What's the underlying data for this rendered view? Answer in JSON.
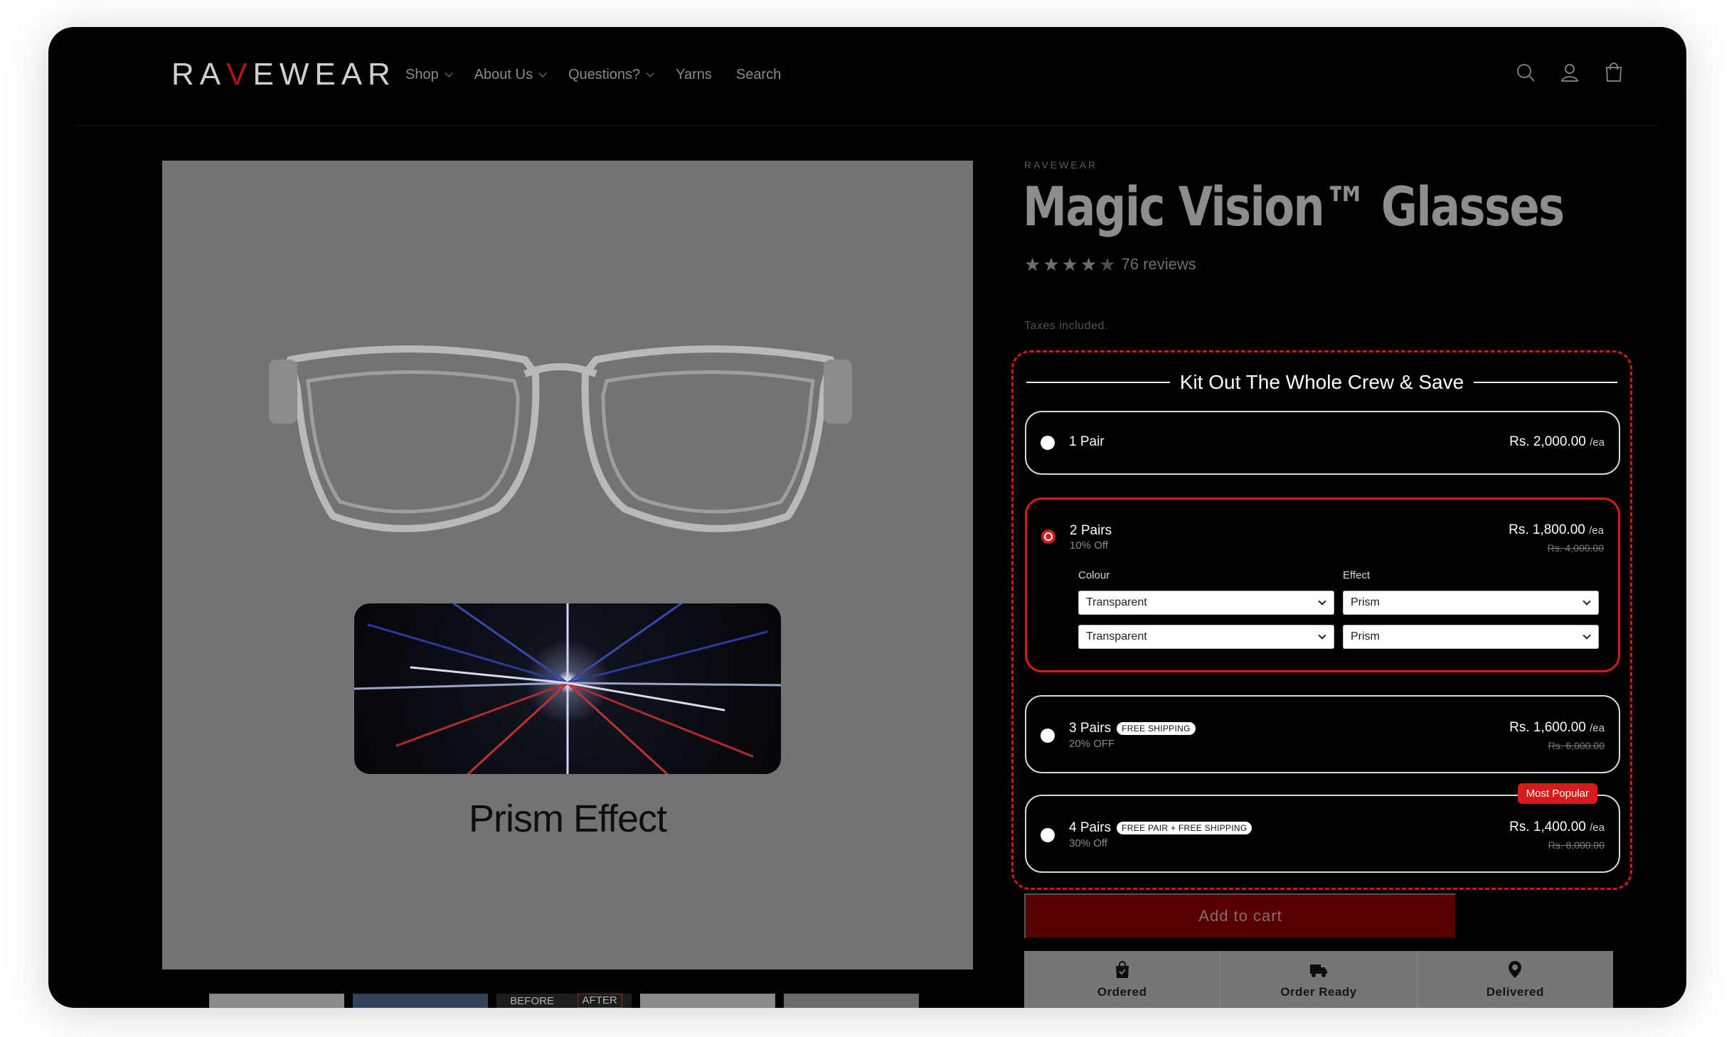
{
  "brand": {
    "logo_text_a": "RA",
    "logo_text_v": "V",
    "logo_text_b": "EWEAR"
  },
  "nav": [
    {
      "label": "Shop",
      "dropdown": true
    },
    {
      "label": "About Us",
      "dropdown": true
    },
    {
      "label": "Questions?",
      "dropdown": true
    },
    {
      "label": "Yarns",
      "dropdown": false
    },
    {
      "label": "Search",
      "dropdown": false
    }
  ],
  "header_icons": [
    "search-icon",
    "account-icon",
    "cart-icon"
  ],
  "media": {
    "overlay_label": "Prism Effect",
    "thumbs": {
      "before": "BEFORE",
      "after": "AFTER"
    }
  },
  "product": {
    "vendor": "RAVEWEAR",
    "title": "Magic Vision™ Glasses",
    "rating": 4.5,
    "reviews": "76 reviews",
    "taxes": "Taxes included."
  },
  "bundle": {
    "title": "Kit Out The Whole Crew & Save",
    "options": [
      {
        "name": "1 Pair",
        "sub": "",
        "pill": "",
        "price": "Rs. 2,000.00",
        "unit": "/ea",
        "compare": "",
        "badge": "",
        "selected": false
      },
      {
        "name": "2 Pairs",
        "sub": "10% Off",
        "pill": "",
        "price": "Rs. 1,800.00",
        "unit": "/ea",
        "compare": "Rs. 4,000.00",
        "badge": "",
        "selected": true
      },
      {
        "name": "3 Pairs",
        "sub": "20% OFF",
        "pill": "FREE SHIPPING",
        "price": "Rs. 1,600.00",
        "unit": "/ea",
        "compare": "Rs. 6,000.00",
        "badge": "",
        "selected": false
      },
      {
        "name": "4 Pairs",
        "sub": "30% Off",
        "pill": "FREE PAIR + FREE SHIPPING",
        "price": "Rs. 1,400.00",
        "unit": "/ea",
        "compare": "Rs. 8,000.00",
        "badge": "Most Popular",
        "selected": false
      }
    ],
    "variant_labels": {
      "colour": "Colour",
      "effect": "Effect"
    },
    "variant_rows": [
      {
        "colour": "Transparent",
        "effect": "Prism"
      },
      {
        "colour": "Transparent",
        "effect": "Prism"
      }
    ]
  },
  "add_to_cart": "Add to cart",
  "timeline": [
    {
      "label": "Ordered",
      "icon": "bag-icon"
    },
    {
      "label": "Order Ready",
      "icon": "truck-icon"
    },
    {
      "label": "Delivered",
      "icon": "location-pin-icon"
    }
  ],
  "colors": {
    "accent": "#d71a1a",
    "atc_bg": "#580101",
    "media_bg": "#737373"
  }
}
